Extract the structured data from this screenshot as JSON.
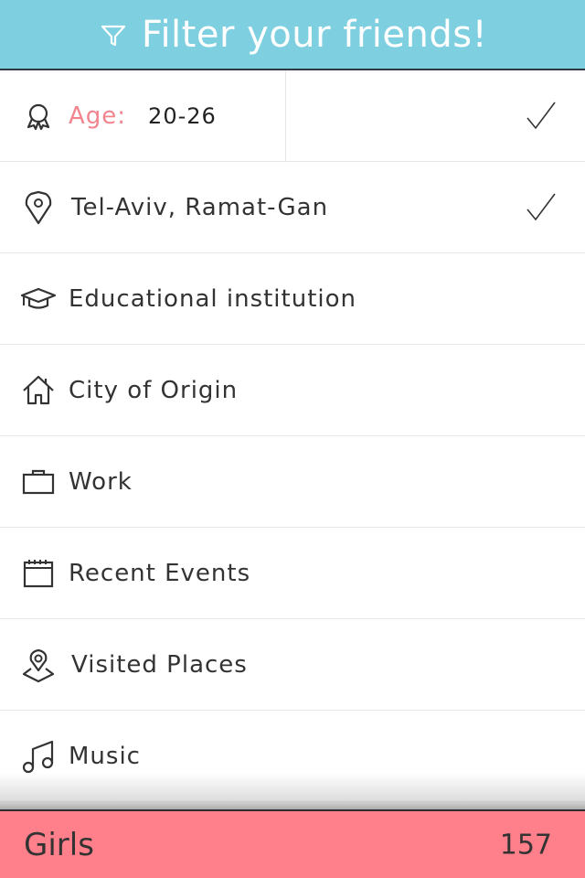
{
  "header": {
    "title": "Filter your friends!",
    "icon": "filter-icon",
    "background": "#7ecfe0"
  },
  "filters": [
    {
      "icon": "award-icon",
      "label": "Age:",
      "value": "20-26",
      "checked": true
    },
    {
      "icon": "location-pin-icon",
      "label": "Tel-Aviv, Ramat-Gan",
      "checked": true
    },
    {
      "icon": "graduation-cap-icon",
      "label": "Educational institution",
      "checked": false
    },
    {
      "icon": "home-icon",
      "label": "City of Origin",
      "checked": false
    },
    {
      "icon": "briefcase-icon",
      "label": "Work",
      "checked": false
    },
    {
      "icon": "calendar-icon",
      "label": "Recent Events",
      "checked": false
    },
    {
      "icon": "map-pin-icon",
      "label": "Visited Places",
      "checked": false
    },
    {
      "icon": "music-note-icon",
      "label": "Music",
      "checked": false
    }
  ],
  "footer": {
    "label": "Girls",
    "count": "157",
    "background": "#ff7f8a"
  },
  "colors": {
    "accent_pink": "#f2848e"
  }
}
